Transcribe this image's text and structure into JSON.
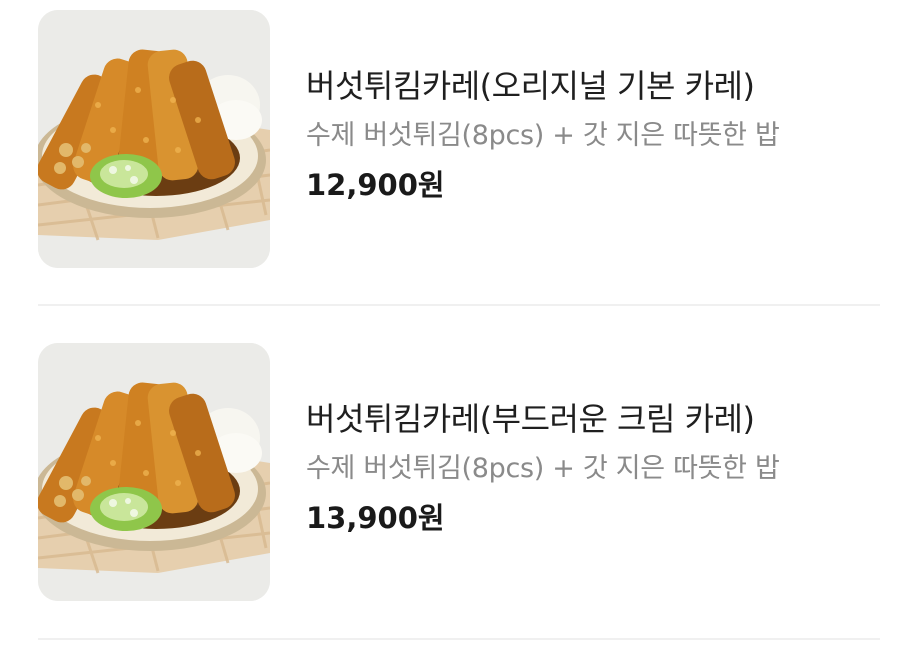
{
  "menu": {
    "items": [
      {
        "title": "버섯튀킴카레(오리지널 기본 카레)",
        "description": "수제 버섯튀김(8pcs) + 갓 지은 따뜻한 밥",
        "price": "12,900원",
        "image": "mushroom-tempura-curry-photo"
      },
      {
        "title": "버섯튀킴카레(부드러운 크림 카레)",
        "description": "수제 버섯튀김(8pcs) + 갓 지은 따뜻한 밥",
        "price": "13,900원",
        "image": "mushroom-tempura-curry-photo"
      }
    ]
  },
  "colors": {
    "title": "#1f1f1f",
    "description": "#8a8a8a",
    "price": "#1a1a1a",
    "divider": "#f0f0f0",
    "thumbnail_bg": "#ececea"
  }
}
